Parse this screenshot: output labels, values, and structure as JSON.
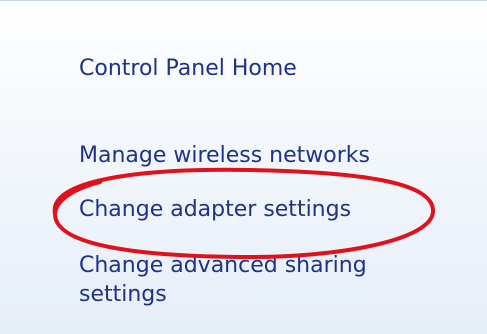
{
  "window": {
    "panel": "left-navigation-pane"
  },
  "nav": {
    "items": [
      {
        "label": "Control Panel Home"
      },
      {
        "label": "Manage wireless networks"
      },
      {
        "label": "Change adapter settings"
      },
      {
        "label": "Change advanced sharing settings"
      }
    ]
  },
  "colors": {
    "link": "#1e3287",
    "highlight_ellipse": "#e0111b",
    "panel_top": "#ffffff",
    "panel_bottom": "#e6eef7"
  },
  "highlight": {
    "target": "Change adapter settings"
  }
}
